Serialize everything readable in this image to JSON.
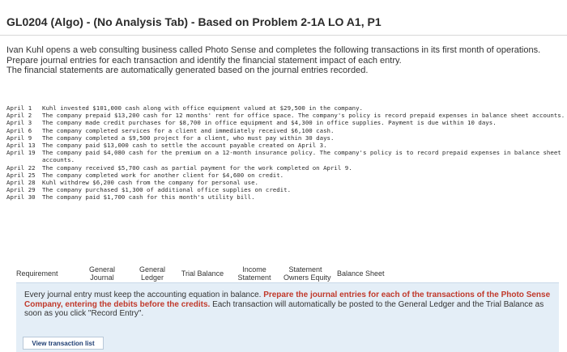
{
  "header": {
    "title": "GL0204 (Algo) - (No Analysis Tab) - Based on Problem 2-1A LO A1, P1"
  },
  "intro": {
    "line1": "Ivan Kuhl opens a web consulting business called Photo Sense and completes the following transactions in its first month of operations.",
    "line2": "Prepare journal entries for each transaction and identify the financial statement impact of each entry.",
    "line3": "The financial statements are automatically generated based on the journal entries recorded."
  },
  "transactions": [
    {
      "date": "April 1",
      "text": "Kuhl invested $101,000 cash along with office equipment valued at $29,500 in the company."
    },
    {
      "date": "April 2",
      "text": "The company prepaid $13,200 cash for 12 months' rent for office space. The company's policy is record prepaid expenses in balance sheet accounts."
    },
    {
      "date": "April 3",
      "text": "The company made credit purchases for $8,700 in office equipment and $4,300 in office supplies. Payment is due within 10 days."
    },
    {
      "date": "April 6",
      "text": "The company completed services for a client and immediately received $6,100 cash."
    },
    {
      "date": "April 9",
      "text": "The company completed a $9,500 project for a client, who must pay within 30 days."
    },
    {
      "date": "April 13",
      "text": "The company paid $13,000 cash to settle the account payable created on April 3."
    },
    {
      "date": "April 19",
      "text": "The company paid $4,080 cash for the premium on a 12-month insurance policy. The company's policy is to record prepaid expenses in balance sheet accounts."
    },
    {
      "date": "April 22",
      "text": "The company received $5,700 cash as partial payment for the work completed on April 9."
    },
    {
      "date": "April 25",
      "text": "The company completed work for another client for $4,600 on credit."
    },
    {
      "date": "April 28",
      "text": "Kuhl withdrew $6,200 cash from the company for personal use."
    },
    {
      "date": "April 29",
      "text": "The company purchased $1,300 of additional office supplies on credit."
    },
    {
      "date": "April 30",
      "text": "The company paid $1,700 cash for this month's utility bill."
    }
  ],
  "tabs": [
    {
      "line1": "Requirement",
      "line2": ""
    },
    {
      "line1": "General",
      "line2": "Journal"
    },
    {
      "line1": "General",
      "line2": "Ledger"
    },
    {
      "line1": "Trial Balance",
      "line2": ""
    },
    {
      "line1": "Income",
      "line2": "Statement"
    },
    {
      "line1": "Statement",
      "line2": "Owners Equity"
    },
    {
      "line1": "Balance Sheet",
      "line2": ""
    }
  ],
  "instruction": {
    "part1": "Every journal entry must keep the accounting equation in balance. ",
    "part2": "Prepare the journal entries for each of the transactions of the Photo Sense Company, entering the debits before the credits.",
    "part3": " Each transaction will automatically be posted to the General Ledger and the Trial Balance as soon as you click \"Record Entry\"."
  },
  "buttons": {
    "view_transaction_list": "View transaction list"
  },
  "colors": {
    "instruction_bg": "#e4eef7",
    "highlight_text": "#c0392b",
    "button_text": "#1f3e73"
  }
}
